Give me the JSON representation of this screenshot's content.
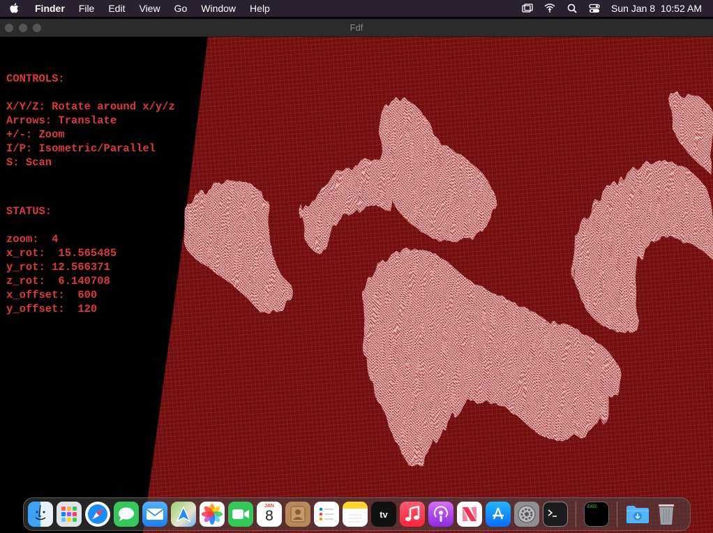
{
  "menubar": {
    "app_name": "Finder",
    "items": [
      "File",
      "Edit",
      "View",
      "Go",
      "Window",
      "Help"
    ],
    "clock": "Sun Jan 8  10:52 AM"
  },
  "window": {
    "title": "Fdf"
  },
  "hud": {
    "controls_header": "CONTROLS:",
    "controls": [
      "X/Y/Z: Rotate around x/y/z",
      "Arrows: Translate",
      "+/-: Zoom",
      "I/P: Isometric/Parallel",
      "S: Scan"
    ],
    "status_header": "STATUS:",
    "status": [
      "zoom:  4",
      "x_rot:  15.565485",
      "y_rot: 12.566371",
      "z_rot:  6.140708",
      "x_offset:  600",
      "y_offset:  120"
    ]
  },
  "calendar": {
    "month": "JAN",
    "day": "8"
  },
  "dock": {
    "apps": [
      "finder",
      "launchpad",
      "safari",
      "messages",
      "mail",
      "maps",
      "photos",
      "facetime",
      "calendar",
      "contacts",
      "reminders",
      "notes",
      "tv",
      "music",
      "podcasts",
      "news",
      "app-store",
      "system-preferences",
      "terminal",
      "exec-window",
      "downloads",
      "trash"
    ],
    "tv_label": "tv",
    "exec_label": "EXEC"
  },
  "colors": {
    "mesh": "#8a1c1c",
    "mesh_bg": "#6e1010",
    "peaks": "#f0d0d0",
    "hud_text": "#d93a3a"
  }
}
